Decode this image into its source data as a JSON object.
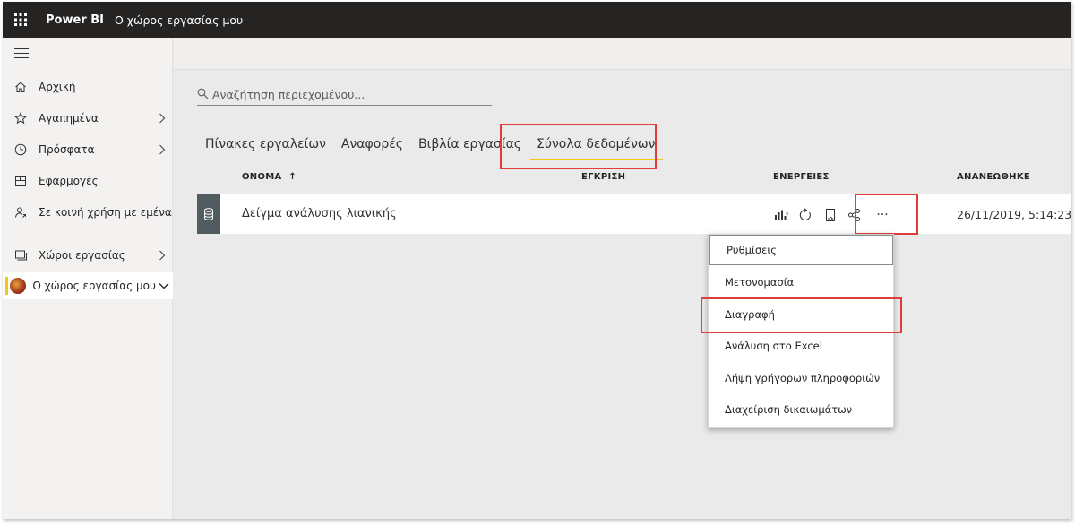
{
  "topbar": {
    "app_name": "Power BI",
    "workspace": "Ο χώρος εργασίας μου"
  },
  "sidebar": {
    "items": [
      {
        "label": "Αρχική",
        "icon": "home-icon"
      },
      {
        "label": "Αγαπημένα",
        "icon": "star-icon"
      },
      {
        "label": "Πρόσφατα",
        "icon": "clock-icon"
      },
      {
        "label": "Εφαρμογές",
        "icon": "apps-icon"
      },
      {
        "label": "Σε κοινή χρήση με εμένα",
        "icon": "shared-icon"
      },
      {
        "label": "Χώροι εργασίας",
        "icon": "workspaces-icon"
      },
      {
        "label": "Ο χώρος εργασίας μου",
        "icon": "avatar"
      }
    ]
  },
  "search": {
    "placeholder": "Αναζήτηση περιεχομένου..."
  },
  "tabs": [
    {
      "label": "Πίνακες εργαλείων"
    },
    {
      "label": "Αναφορές"
    },
    {
      "label": "Βιβλία εργασίας"
    },
    {
      "label": "Σύνολα δεδομένων",
      "selected": true
    }
  ],
  "table": {
    "columns": {
      "name": "ΟΝΟΜΑ",
      "sort_arrow": "↑",
      "endorsement": "ΕΓΚΡΙΣΗ",
      "actions": "ΕΝΕΡΓΕΙΕΣ",
      "refreshed": "ΑΝΑΝΕΩΘΗΚΕ"
    },
    "rows": [
      {
        "name": "Δείγμα ανάλυσης λιανικής",
        "refreshed": "26/11/2019, 5:14:23",
        "more_label": "···"
      }
    ]
  },
  "context_menu": {
    "items": [
      {
        "label": "Ρυθμίσεις"
      },
      {
        "label": "Μετονομασία"
      },
      {
        "label": "Διαγραφή"
      },
      {
        "label": "Ανάλυση στο Excel"
      },
      {
        "label": "Λήψη γρήγορων πληροφοριών"
      },
      {
        "label": "Διαχείριση δικαιωμάτων"
      }
    ]
  },
  "colors": {
    "topbar": "#252423",
    "accent": "#f2c811",
    "highlight": "#e03c3c"
  }
}
